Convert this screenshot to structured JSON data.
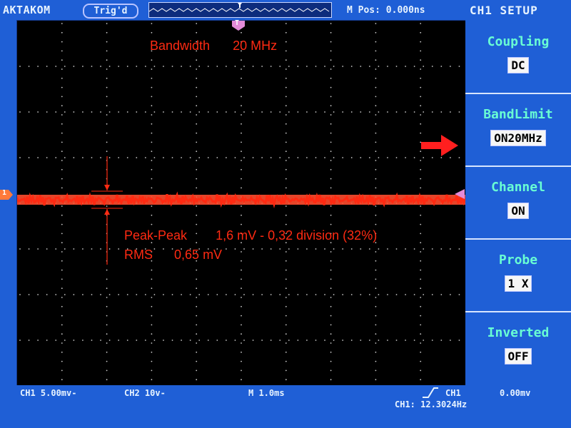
{
  "brand": "AKTAKOM",
  "trigger_state": "Trig'd",
  "m_pos": "M Pos: 0.000ns",
  "menu_title": "CH1 SETUP",
  "annotation": {
    "bandwidth_label": "Bandwidth",
    "bandwidth_value": "20 MHz",
    "peak_peak_label": "Peak-Peak",
    "peak_peak_value": "1,6 mV - 0,32 division (32%)",
    "rms_label": "RMS",
    "rms_value": "0,65 mV"
  },
  "menu": {
    "items": [
      {
        "title": "Coupling",
        "value": "DC"
      },
      {
        "title": "BandLimit",
        "value": "ON20MHz"
      },
      {
        "title": "Channel",
        "value": "ON"
      },
      {
        "title": "Probe",
        "value": "1 X"
      },
      {
        "title": "Inverted",
        "value": "OFF"
      }
    ]
  },
  "status": {
    "ch1_scale": "CH1 5.00mv-",
    "ch2_scale": "CH2 10v-",
    "time_scale": "M  1.0ms",
    "trigger_source": "CH1",
    "trigger_level": "0.00mv",
    "frequency": "CH1: 12.3024Hz"
  },
  "markers": {
    "trigger_marker": "T",
    "channel_marker": "1"
  },
  "colors": {
    "background": "#1f5fd6",
    "screen": "#000000",
    "trace": "#ff4b2d",
    "annotation": "#ff2a12",
    "menu_title": "#69ffd4",
    "trigger_marker": "#e38bd8"
  }
}
